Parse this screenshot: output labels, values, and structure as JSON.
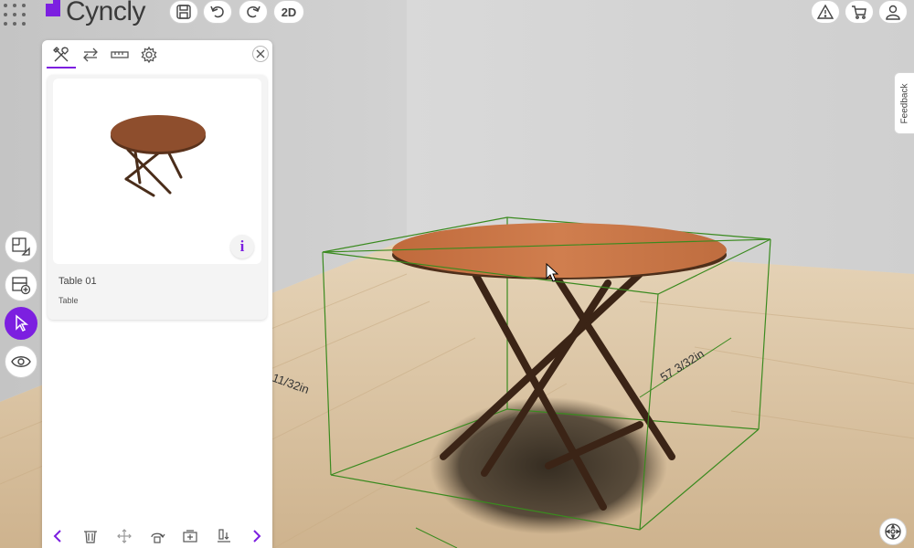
{
  "app": {
    "logo_text": "Cyncly"
  },
  "toolbar": {
    "view_toggle_label": "2D"
  },
  "feedback": {
    "label": "Feedback"
  },
  "panel": {
    "tabs": [
      {
        "icon": "tools-icon",
        "active": true
      },
      {
        "icon": "swap-icon",
        "active": false
      },
      {
        "icon": "ruler-icon",
        "active": false
      },
      {
        "icon": "gear-icon",
        "active": false
      }
    ],
    "item": {
      "name": "Table 01",
      "category": "Table"
    },
    "info_label": "i"
  },
  "scene": {
    "dimension_left": "11/32in",
    "dimension_right": "57 3/32in"
  },
  "colors": {
    "accent": "#7c1fe0",
    "bbox": "#3a8a1f",
    "table_top": "#c97444",
    "table_legs": "#3b2416"
  }
}
